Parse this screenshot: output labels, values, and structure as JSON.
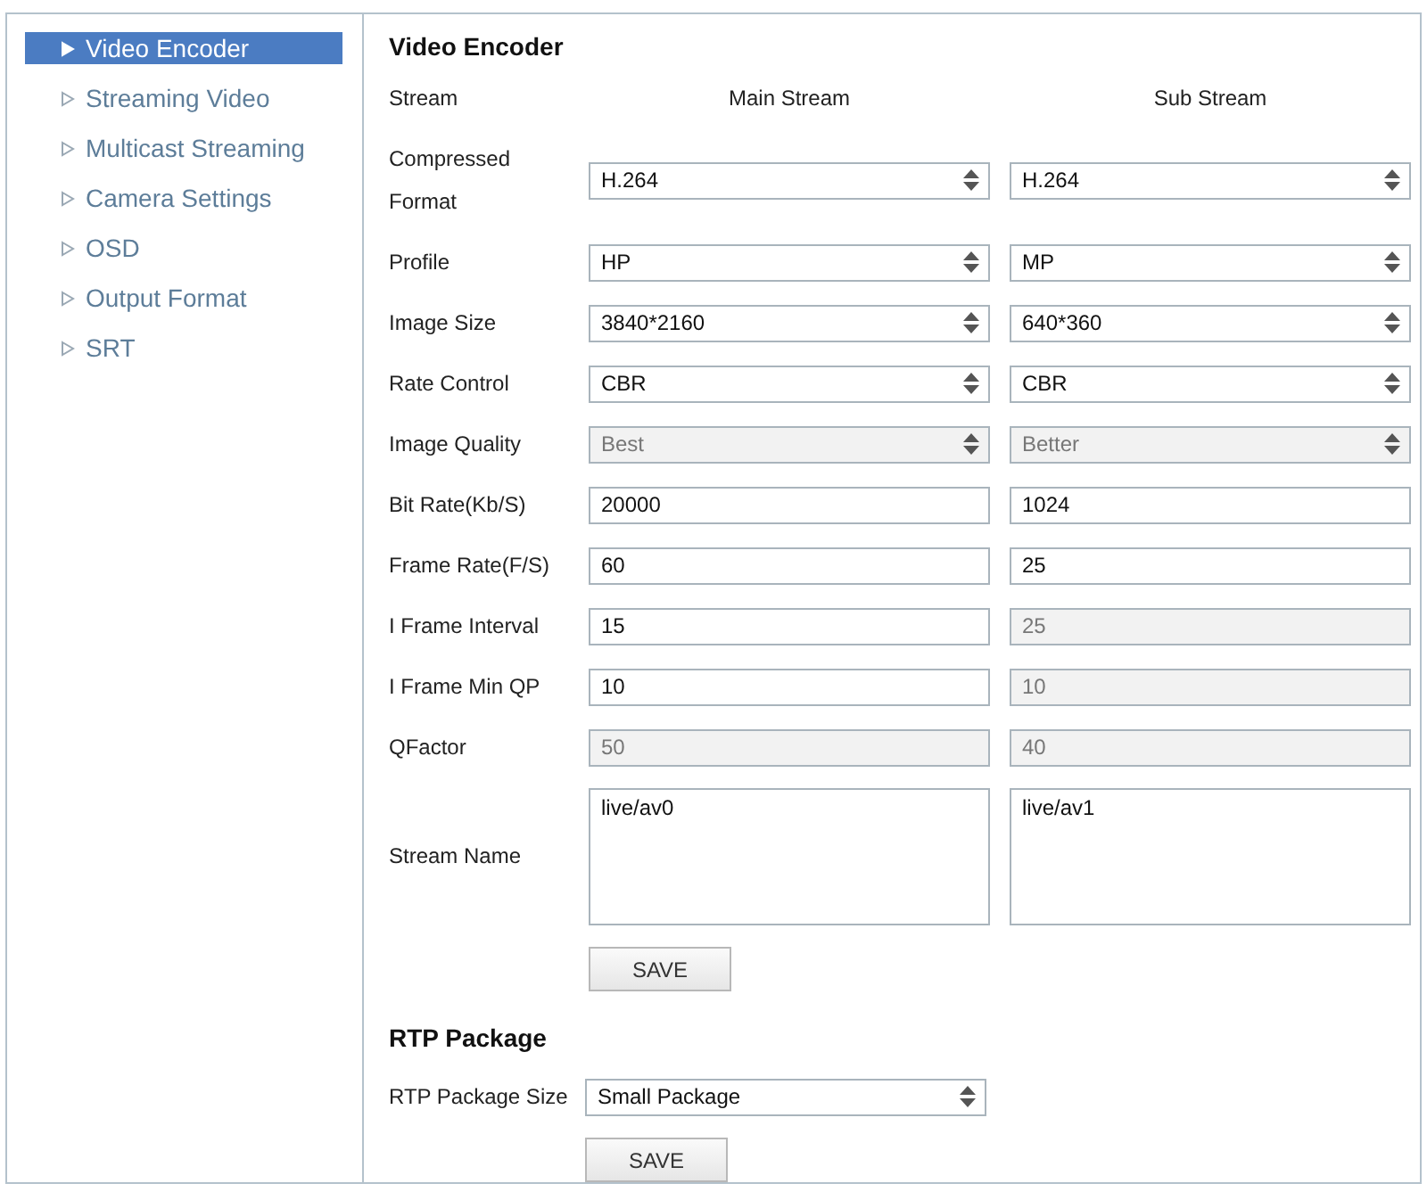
{
  "sidebar": {
    "items": [
      {
        "label": "Video Encoder",
        "selected": true
      },
      {
        "label": "Streaming Video",
        "selected": false
      },
      {
        "label": "Multicast Streaming",
        "selected": false
      },
      {
        "label": "Camera Settings",
        "selected": false
      },
      {
        "label": "OSD",
        "selected": false
      },
      {
        "label": "Output Format",
        "selected": false
      },
      {
        "label": "SRT",
        "selected": false
      }
    ]
  },
  "video_encoder": {
    "title": "Video Encoder",
    "columns": [
      "Stream",
      "Main Stream",
      "Sub Stream"
    ],
    "rows": [
      {
        "label": "Compressed Format",
        "kind": "select",
        "main": {
          "value": "H.264",
          "disabled": false
        },
        "sub": {
          "value": "H.264",
          "disabled": false
        }
      },
      {
        "label": "Profile",
        "kind": "select",
        "main": {
          "value": "HP",
          "disabled": false
        },
        "sub": {
          "value": "MP",
          "disabled": false
        }
      },
      {
        "label": "Image Size",
        "kind": "select",
        "main": {
          "value": "3840*2160",
          "disabled": false
        },
        "sub": {
          "value": "640*360",
          "disabled": false
        }
      },
      {
        "label": "Rate Control",
        "kind": "select",
        "main": {
          "value": "CBR",
          "disabled": false
        },
        "sub": {
          "value": "CBR",
          "disabled": false
        }
      },
      {
        "label": "Image Quality",
        "kind": "select",
        "main": {
          "value": "Best",
          "disabled": true
        },
        "sub": {
          "value": "Better",
          "disabled": true
        }
      },
      {
        "label": "Bit Rate(Kb/S)",
        "kind": "input",
        "main": {
          "value": "20000",
          "disabled": false
        },
        "sub": {
          "value": "1024",
          "disabled": false
        }
      },
      {
        "label": "Frame Rate(F/S)",
        "kind": "input",
        "main": {
          "value": "60",
          "disabled": false
        },
        "sub": {
          "value": "25",
          "disabled": false
        }
      },
      {
        "label": "I Frame Interval",
        "kind": "input",
        "main": {
          "value": "15",
          "disabled": false
        },
        "sub": {
          "value": "25",
          "disabled": true
        }
      },
      {
        "label": "I Frame Min QP",
        "kind": "input",
        "main": {
          "value": "10",
          "disabled": false
        },
        "sub": {
          "value": "10",
          "disabled": true
        }
      },
      {
        "label": "QFactor",
        "kind": "input",
        "main": {
          "value": "50",
          "disabled": true
        },
        "sub": {
          "value": "40",
          "disabled": true
        }
      },
      {
        "label": "Stream Name",
        "kind": "textarea",
        "main": {
          "value": "live/av0",
          "disabled": false
        },
        "sub": {
          "value": "live/av1",
          "disabled": false
        }
      }
    ],
    "save_button": "SAVE"
  },
  "rtp_package": {
    "title": "RTP Package",
    "label": "RTP Package Size",
    "value": "Small Package",
    "save_button": "SAVE"
  }
}
